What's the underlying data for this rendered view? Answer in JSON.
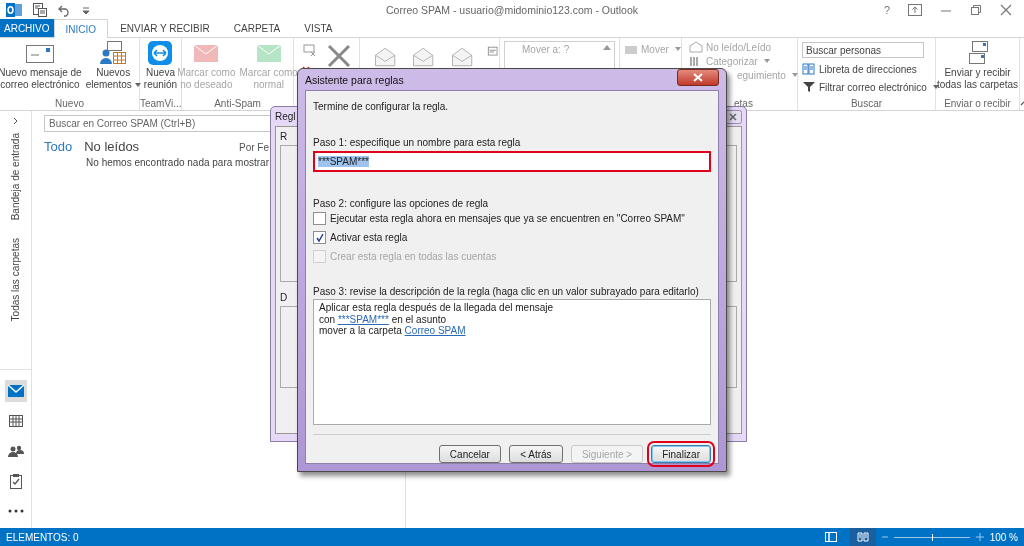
{
  "window": {
    "title": "Correo SPAM - usuario@midominio123.com - Outlook",
    "help": "?"
  },
  "tabs": [
    {
      "label": "ARCHIVO",
      "kind": "file",
      "selected": false
    },
    {
      "label": "INICIO",
      "kind": "tab",
      "selected": true
    },
    {
      "label": "ENVIAR Y RECIBIR",
      "kind": "tab",
      "selected": false
    },
    {
      "label": "CARPETA",
      "kind": "tab",
      "selected": false
    },
    {
      "label": "VISTA",
      "kind": "tab",
      "selected": false
    }
  ],
  "ribbon": {
    "new": {
      "label": "Nuevo",
      "buttons": [
        {
          "label": "Nuevo mensaje de\ncorreo electrónico",
          "dropdown": false
        },
        {
          "label": "Nuevos\nelementos",
          "dropdown": true
        }
      ]
    },
    "teamviewer": {
      "label": "TeamVi...",
      "button": "Nueva\nreunión"
    },
    "anti_spam": {
      "label": "Anti-Spam",
      "buttons": [
        {
          "label": "Marcar como\nno deseado",
          "disabled": true
        },
        {
          "label": "Marcar como\nnormal",
          "disabled": true
        }
      ]
    },
    "quick_steps": {
      "items": [
        "Mover a: ?"
      ]
    },
    "move": {
      "items": [
        {
          "label": "Mover",
          "dropdown": true
        }
      ]
    },
    "tags": {
      "label": "etas",
      "items": [
        {
          "label": "No leído/Leído",
          "dropdown": false
        },
        {
          "label": "Categorizar",
          "dropdown": true
        },
        {
          "label": "eguimiento",
          "dropdown": true
        }
      ]
    },
    "find": {
      "label": "Buscar",
      "search": {
        "placeholder": "Buscar personas"
      },
      "items": [
        {
          "label": "Libreta de direcciones",
          "dropdown": false
        },
        {
          "label": "Filtrar correo electrónico",
          "dropdown": true
        }
      ]
    },
    "send_receive": {
      "label": "Enviar o recibir",
      "button": "Enviar y recibir\ntodas las carpetas"
    }
  },
  "navigation": {
    "folders": [
      "Bandeja de entrada",
      "Todas las carpetas"
    ],
    "modules": [
      {
        "kind": "mail",
        "selected": true
      },
      {
        "kind": "calendar",
        "selected": false
      },
      {
        "kind": "people",
        "selected": false
      },
      {
        "kind": "tasks",
        "selected": false
      },
      {
        "kind": "more",
        "selected": false
      }
    ]
  },
  "message_list": {
    "search": {
      "placeholder": "Buscar en Correo SPAM (Ctrl+B)"
    },
    "filters": [
      {
        "label": "Todo",
        "selected": true
      },
      {
        "label": "No leídos",
        "selected": false
      }
    ],
    "sort": "Por Fe",
    "empty_message": "No hemos encontrado nada para mostrar"
  },
  "rules_dialog": {
    "title": "Regl",
    "labels": [
      "R",
      "D"
    ]
  },
  "wizard": {
    "title": "Asistente para reglas",
    "intro": "Termine de configurar la regla.",
    "step1": {
      "label": "Paso 1: especifique un nombre para esta regla",
      "field": {
        "value": "***SPAM***",
        "text_selected": true,
        "highlighted": true
      }
    },
    "step2": {
      "label": "Paso 2: configure las opciones de regla",
      "options": [
        {
          "label": "Ejecutar esta regla ahora en mensajes que ya se encuentren en \"Correo SPAM\"",
          "checked": false,
          "disabled": false
        },
        {
          "label": "Activar esta regla",
          "checked": true,
          "disabled": false
        },
        {
          "label": "Crear esta regla en todas las cuentas",
          "checked": false,
          "disabled": true
        }
      ]
    },
    "step3": {
      "label": "Paso 3: revise la descripción de la regla (haga clic en un valor subrayado para editarlo)",
      "description": [
        [
          {
            "text": "Aplicar esta regla después de la llegada del mensaje",
            "link": false
          }
        ],
        [
          {
            "text": "con ",
            "link": false
          },
          {
            "text": "***SPAM***",
            "link": true
          },
          {
            "text": " en el asunto",
            "link": false
          }
        ],
        [
          {
            "text": "mover a la carpeta ",
            "link": false
          },
          {
            "text": "Correo SPAM",
            "link": true
          }
        ]
      ]
    },
    "buttons": [
      {
        "label": "Cancelar",
        "disabled": false,
        "default": false,
        "highlighted": false
      },
      {
        "label": "< Atrás",
        "disabled": false,
        "default": false,
        "highlighted": false
      },
      {
        "label": "Siguiente >",
        "disabled": true,
        "default": false,
        "highlighted": false
      },
      {
        "label": "Finalizar",
        "disabled": false,
        "default": true,
        "highlighted": true
      }
    ]
  },
  "status_bar": {
    "items": "ELEMENTOS: 0",
    "views": [
      {
        "kind": "normal",
        "selected": false
      },
      {
        "kind": "reading",
        "selected": true
      }
    ],
    "zoom": {
      "level": 0.5,
      "reading": "100 %"
    }
  }
}
